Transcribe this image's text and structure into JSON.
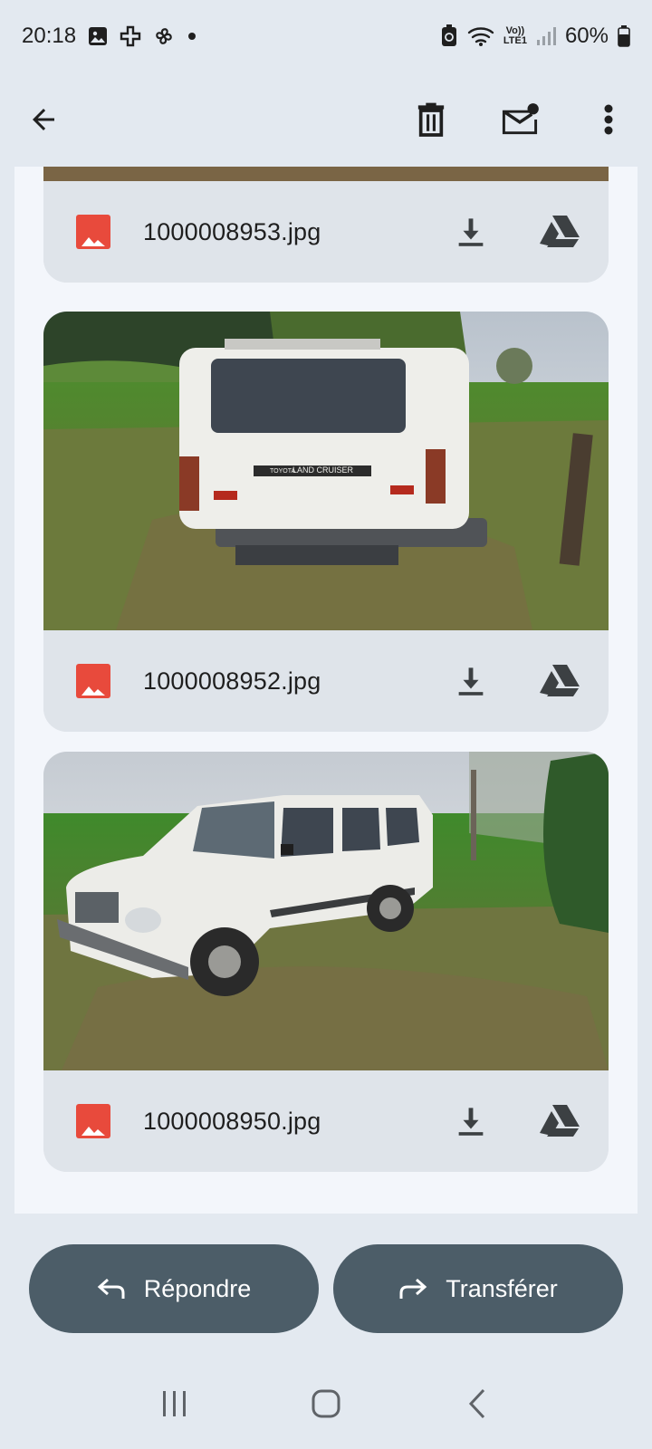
{
  "status_bar": {
    "time": "20:18",
    "lte_top": "Vo))",
    "lte_bottom": "LTE1",
    "battery": "60%"
  },
  "app_bar": {
    "icons": [
      "back-arrow-icon",
      "trash-icon",
      "mark-unread-icon",
      "more-vert-icon"
    ]
  },
  "attachments": [
    {
      "file_name": "1000008953.jpg",
      "photo": "partial-image-top"
    },
    {
      "file_name": "1000008952.jpg",
      "photo": "white Toyota Land Cruiser rear view"
    },
    {
      "file_name": "1000008950.jpg",
      "photo": "white Toyota Land Cruiser front side view"
    }
  ],
  "photo_text": {
    "badge_small": "TOYOTA",
    "badge": "LAND CRUISER"
  },
  "actions": {
    "reply_label": "Répondre",
    "forward_label": "Transférer"
  },
  "colors": {
    "accent_pill": "#4c5d68",
    "file_icon": "#e84a3c",
    "background": "#e3e9f0"
  }
}
